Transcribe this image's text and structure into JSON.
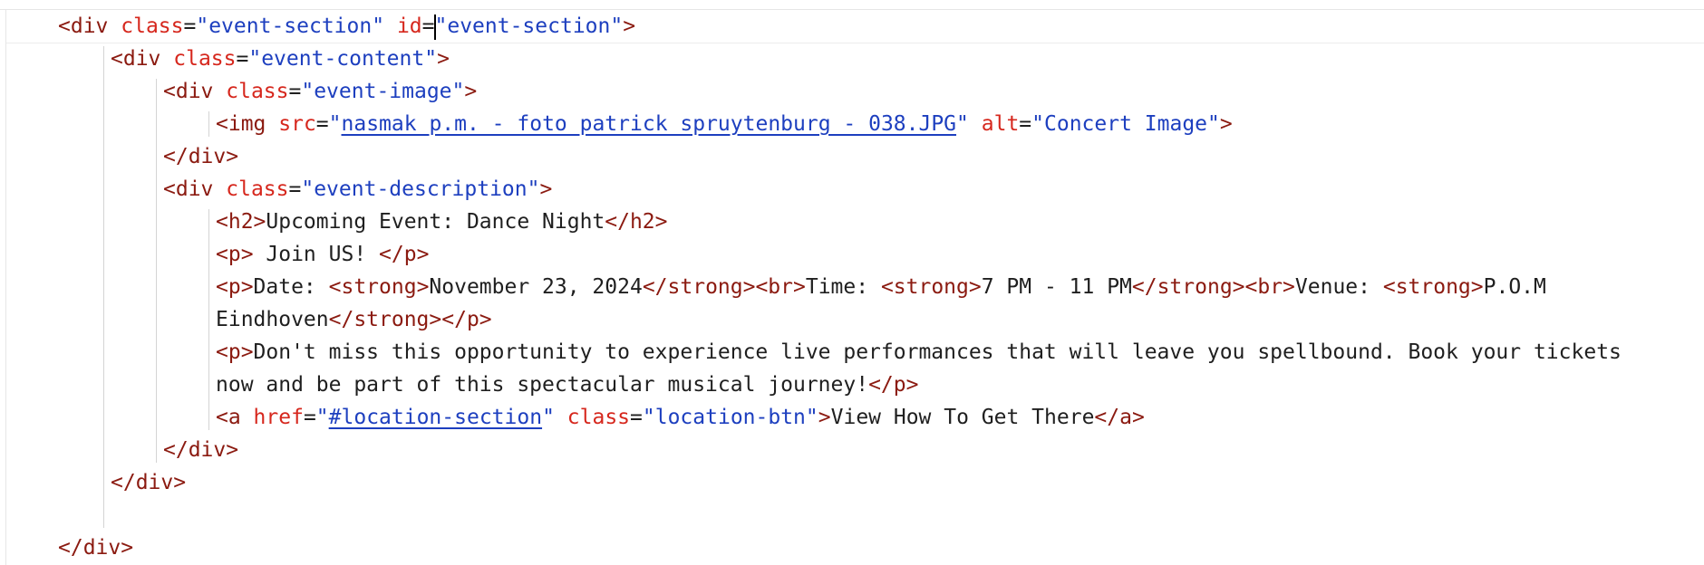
{
  "editor": {
    "lines": [
      {
        "indent": 0,
        "tokens": [
          [
            "tag",
            "<div "
          ],
          [
            "attr",
            "class"
          ],
          [
            "txt",
            "="
          ],
          [
            "val",
            "\"event-section\""
          ],
          [
            "txt",
            " "
          ],
          [
            "attr",
            "id"
          ],
          [
            "txt",
            "="
          ],
          [
            "caret",
            ""
          ],
          [
            "val",
            "\"event-section\""
          ],
          [
            "tag",
            ">"
          ]
        ]
      },
      {
        "indent": 1,
        "tokens": [
          [
            "tag",
            "<div "
          ],
          [
            "attr",
            "class"
          ],
          [
            "txt",
            "="
          ],
          [
            "val",
            "\"event-content\""
          ],
          [
            "tag",
            ">"
          ]
        ]
      },
      {
        "indent": 2,
        "tokens": [
          [
            "tag",
            "<div "
          ],
          [
            "attr",
            "class"
          ],
          [
            "txt",
            "="
          ],
          [
            "val",
            "\"event-image\""
          ],
          [
            "tag",
            ">"
          ]
        ]
      },
      {
        "indent": 3,
        "tokens": [
          [
            "tag",
            "<img "
          ],
          [
            "attr",
            "src"
          ],
          [
            "txt",
            "="
          ],
          [
            "val",
            "\""
          ],
          [
            "link",
            "nasmak p.m. - foto patrick spruytenburg - 038.JPG"
          ],
          [
            "val",
            "\""
          ],
          [
            "txt",
            " "
          ],
          [
            "attr",
            "alt"
          ],
          [
            "txt",
            "="
          ],
          [
            "val",
            "\"Concert Image\""
          ],
          [
            "tag",
            ">"
          ]
        ]
      },
      {
        "indent": 2,
        "tokens": [
          [
            "tag",
            "</div>"
          ]
        ]
      },
      {
        "indent": 2,
        "tokens": [
          [
            "tag",
            "<div "
          ],
          [
            "attr",
            "class"
          ],
          [
            "txt",
            "="
          ],
          [
            "val",
            "\"event-description\""
          ],
          [
            "tag",
            ">"
          ]
        ]
      },
      {
        "indent": 3,
        "tokens": [
          [
            "tag",
            "<h2>"
          ],
          [
            "txt",
            "Upcoming Event: Dance Night"
          ],
          [
            "tag",
            "</h2>"
          ]
        ]
      },
      {
        "indent": 3,
        "tokens": [
          [
            "tag",
            "<p>"
          ],
          [
            "txt",
            " Join US! "
          ],
          [
            "tag",
            "</p>"
          ]
        ]
      },
      {
        "indent": 3,
        "tokens": [
          [
            "tag",
            "<p>"
          ],
          [
            "txt",
            "Date: "
          ],
          [
            "tag",
            "<strong>"
          ],
          [
            "txt",
            "November 23, 2024"
          ],
          [
            "tag",
            "</strong><br>"
          ],
          [
            "txt",
            "Time: "
          ],
          [
            "tag",
            "<strong>"
          ],
          [
            "txt",
            "7 PM - 11 PM"
          ],
          [
            "tag",
            "</strong><br>"
          ],
          [
            "txt",
            "Venue: "
          ],
          [
            "tag",
            "<strong>"
          ],
          [
            "txt",
            "P.O.M"
          ]
        ]
      },
      {
        "indent": 3,
        "tokens": [
          [
            "txt",
            "Eindhoven"
          ],
          [
            "tag",
            "</strong></p>"
          ]
        ]
      },
      {
        "indent": 3,
        "tokens": [
          [
            "tag",
            "<p>"
          ],
          [
            "txt",
            "Don't miss this opportunity to experience live performances that will leave you spellbound. Book your tickets"
          ]
        ]
      },
      {
        "indent": 3,
        "tokens": [
          [
            "txt",
            "now and be part of this spectacular musical journey!"
          ],
          [
            "tag",
            "</p>"
          ]
        ]
      },
      {
        "indent": 3,
        "tokens": [
          [
            "tag",
            "<a "
          ],
          [
            "attr",
            "href"
          ],
          [
            "txt",
            "="
          ],
          [
            "val",
            "\""
          ],
          [
            "link",
            "#location-section"
          ],
          [
            "val",
            "\""
          ],
          [
            "txt",
            " "
          ],
          [
            "attr",
            "class"
          ],
          [
            "txt",
            "="
          ],
          [
            "val",
            "\"location-btn\""
          ],
          [
            "tag",
            ">"
          ],
          [
            "txt",
            "View How To Get There"
          ],
          [
            "tag",
            "</a>"
          ]
        ]
      },
      {
        "indent": 2,
        "tokens": [
          [
            "tag",
            "</div>"
          ]
        ]
      },
      {
        "indent": 1,
        "tokens": [
          [
            "tag",
            "</div>"
          ]
        ]
      },
      {
        "indent": 0,
        "tokens": []
      },
      {
        "indent": 0,
        "tokens": [
          [
            "tag",
            "</div>"
          ]
        ]
      }
    ]
  }
}
